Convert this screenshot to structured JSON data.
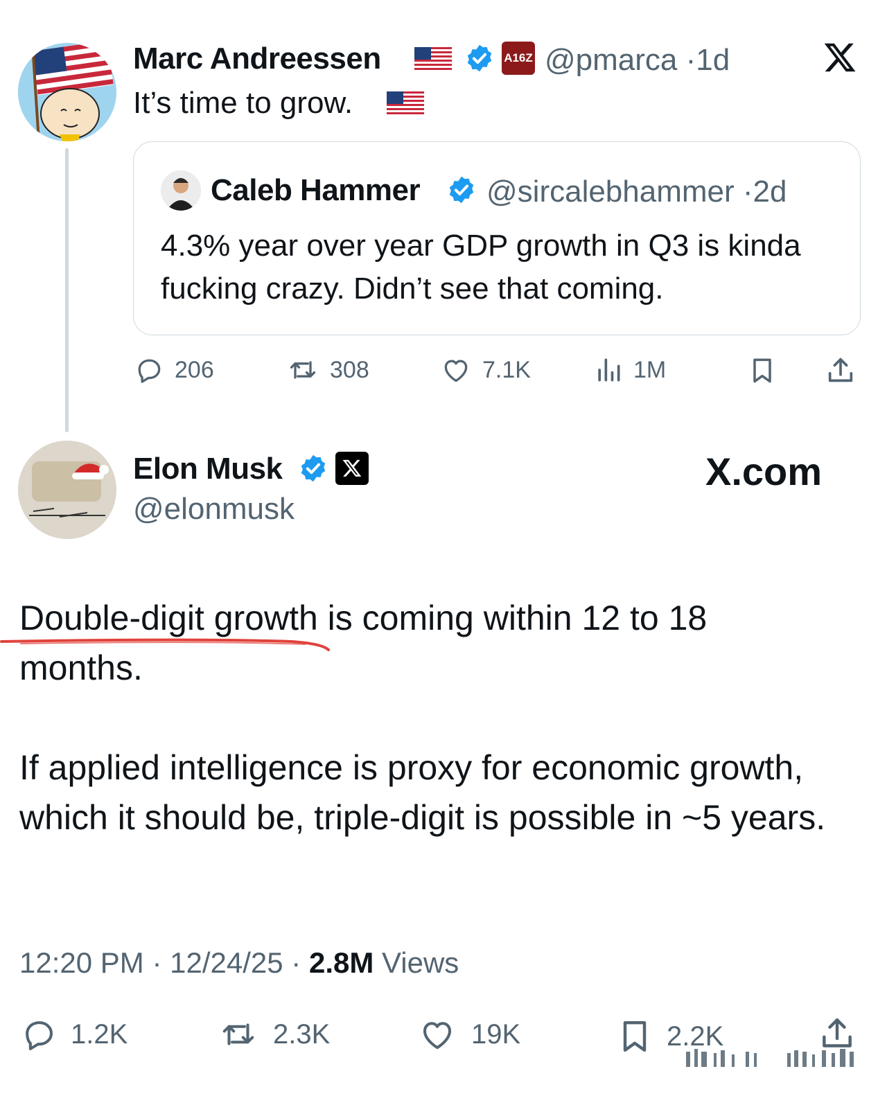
{
  "main_tweet": {
    "author_name": "Marc Andreessen",
    "affiliate_badge": "A16Z",
    "handle": "@pmarca",
    "separator": "·",
    "time_ago": "1d",
    "text": "It’s time to grow."
  },
  "quoted_tweet": {
    "author_name": "Caleb Hammer",
    "handle": "@sircalebhammer",
    "separator": "·",
    "time_ago": "2d",
    "text": "4.3% year over year GDP growth in Q3 is kinda fucking crazy. Didn’t see that coming."
  },
  "main_actions": {
    "replies": "206",
    "reposts": "308",
    "likes": "7.1K",
    "views": "1M"
  },
  "reply_tweet": {
    "author_name": "Elon Musk",
    "handle": "@elonmusk",
    "brand_logo": "X.com",
    "paragraph_1": "Double-digit growth is coming within 12 to 18 months.",
    "paragraph_2": "If applied intelligence is proxy for economic growth, which it should be, triple-digit is possible in ~5 years.",
    "timestamp": "12:20 PM",
    "date": "12/24/25",
    "separator": "·",
    "views_count": "2.8M",
    "views_label": "Views"
  },
  "reply_actions": {
    "replies": "1.2K",
    "reposts": "2.3K",
    "likes": "19K",
    "bookmarks": "2.2K"
  },
  "colors": {
    "verified_blue": "#1d9bf0",
    "text_dark": "#0f1419",
    "text_muted": "#536471",
    "underline_red": "#e0433c",
    "a16z_red": "#8c1a1a"
  },
  "icons": [
    "x-logo-icon",
    "verified-badge-icon",
    "us-flag-icon",
    "reply-icon",
    "repost-icon",
    "like-icon",
    "views-icon",
    "bookmark-icon",
    "share-icon"
  ]
}
